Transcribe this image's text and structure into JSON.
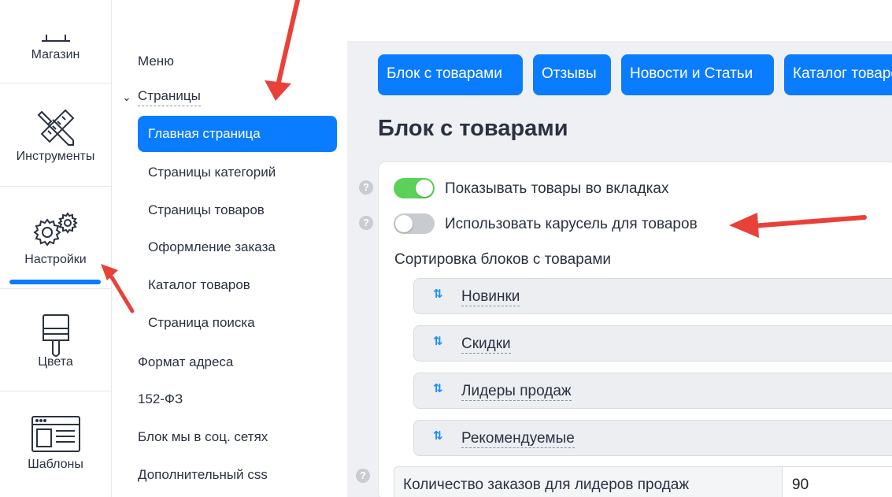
{
  "rail": {
    "items": [
      {
        "label": "Магазин"
      },
      {
        "label": "Инструменты"
      },
      {
        "label": "Настройки"
      },
      {
        "label": "Цвета"
      },
      {
        "label": "Шаблоны"
      }
    ]
  },
  "subnav": {
    "menu": "Меню",
    "pages": "Страницы",
    "pages_children": [
      "Главная страница",
      "Страницы категорий",
      "Страницы товаров",
      "Оформление заказа",
      "Каталог товаров",
      "Страница поиска"
    ],
    "address_format": "Формат адреса",
    "fz152": "152-ФЗ",
    "social": "Блок мы в соц. сетях",
    "css": "Дополнительный css"
  },
  "main": {
    "tabs": [
      {
        "label": "Блок с товарами"
      },
      {
        "label": "Отзывы"
      },
      {
        "label": "Новости и Статьи"
      },
      {
        "label": "Каталог товаров"
      }
    ],
    "title": "Блок с товарами",
    "options": [
      {
        "label": "Показывать товары во вкладках",
        "enabled": true
      },
      {
        "label": "Использовать карусель для товаров",
        "enabled": false
      }
    ],
    "sort_label": "Сортировка блоков с товарами",
    "sort_items": [
      "Новинки",
      "Скидки",
      "Лидеры продаж",
      "Рекомендуемые"
    ],
    "qty_label": "Количество заказов для лидеров продаж",
    "qty_value": "90",
    "help_glyph": "?",
    "sort_glyph": "⇅"
  },
  "colors": {
    "accent": "#0a7cff",
    "toggle_on": "#5bd15a",
    "toggle_off": "#c8cbcf",
    "annotation_arrow": "#e8413a"
  }
}
